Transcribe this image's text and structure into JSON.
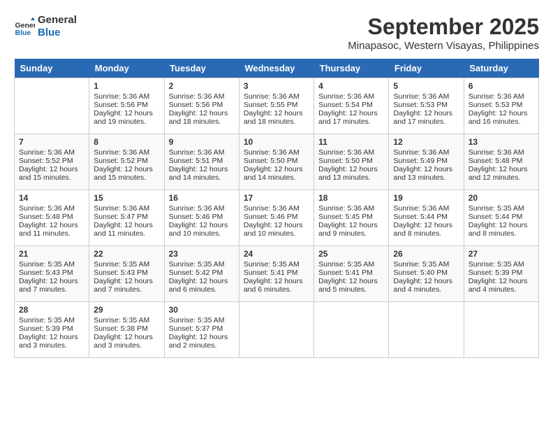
{
  "logo": {
    "line1": "General",
    "line2": "Blue"
  },
  "title": "September 2025",
  "location": "Minapasoc, Western Visayas, Philippines",
  "days_header": [
    "Sunday",
    "Monday",
    "Tuesday",
    "Wednesday",
    "Thursday",
    "Friday",
    "Saturday"
  ],
  "weeks": [
    [
      {
        "day": "",
        "content": ""
      },
      {
        "day": "1",
        "content": "Sunrise: 5:36 AM\nSunset: 5:56 PM\nDaylight: 12 hours\nand 19 minutes."
      },
      {
        "day": "2",
        "content": "Sunrise: 5:36 AM\nSunset: 5:56 PM\nDaylight: 12 hours\nand 18 minutes."
      },
      {
        "day": "3",
        "content": "Sunrise: 5:36 AM\nSunset: 5:55 PM\nDaylight: 12 hours\nand 18 minutes."
      },
      {
        "day": "4",
        "content": "Sunrise: 5:36 AM\nSunset: 5:54 PM\nDaylight: 12 hours\nand 17 minutes."
      },
      {
        "day": "5",
        "content": "Sunrise: 5:36 AM\nSunset: 5:53 PM\nDaylight: 12 hours\nand 17 minutes."
      },
      {
        "day": "6",
        "content": "Sunrise: 5:36 AM\nSunset: 5:53 PM\nDaylight: 12 hours\nand 16 minutes."
      }
    ],
    [
      {
        "day": "7",
        "content": "Sunrise: 5:36 AM\nSunset: 5:52 PM\nDaylight: 12 hours\nand 15 minutes."
      },
      {
        "day": "8",
        "content": "Sunrise: 5:36 AM\nSunset: 5:52 PM\nDaylight: 12 hours\nand 15 minutes."
      },
      {
        "day": "9",
        "content": "Sunrise: 5:36 AM\nSunset: 5:51 PM\nDaylight: 12 hours\nand 14 minutes."
      },
      {
        "day": "10",
        "content": "Sunrise: 5:36 AM\nSunset: 5:50 PM\nDaylight: 12 hours\nand 14 minutes."
      },
      {
        "day": "11",
        "content": "Sunrise: 5:36 AM\nSunset: 5:50 PM\nDaylight: 12 hours\nand 13 minutes."
      },
      {
        "day": "12",
        "content": "Sunrise: 5:36 AM\nSunset: 5:49 PM\nDaylight: 12 hours\nand 13 minutes."
      },
      {
        "day": "13",
        "content": "Sunrise: 5:36 AM\nSunset: 5:48 PM\nDaylight: 12 hours\nand 12 minutes."
      }
    ],
    [
      {
        "day": "14",
        "content": "Sunrise: 5:36 AM\nSunset: 5:48 PM\nDaylight: 12 hours\nand 11 minutes."
      },
      {
        "day": "15",
        "content": "Sunrise: 5:36 AM\nSunset: 5:47 PM\nDaylight: 12 hours\nand 11 minutes."
      },
      {
        "day": "16",
        "content": "Sunrise: 5:36 AM\nSunset: 5:46 PM\nDaylight: 12 hours\nand 10 minutes."
      },
      {
        "day": "17",
        "content": "Sunrise: 5:36 AM\nSunset: 5:46 PM\nDaylight: 12 hours\nand 10 minutes."
      },
      {
        "day": "18",
        "content": "Sunrise: 5:36 AM\nSunset: 5:45 PM\nDaylight: 12 hours\nand 9 minutes."
      },
      {
        "day": "19",
        "content": "Sunrise: 5:36 AM\nSunset: 5:44 PM\nDaylight: 12 hours\nand 8 minutes."
      },
      {
        "day": "20",
        "content": "Sunrise: 5:35 AM\nSunset: 5:44 PM\nDaylight: 12 hours\nand 8 minutes."
      }
    ],
    [
      {
        "day": "21",
        "content": "Sunrise: 5:35 AM\nSunset: 5:43 PM\nDaylight: 12 hours\nand 7 minutes."
      },
      {
        "day": "22",
        "content": "Sunrise: 5:35 AM\nSunset: 5:43 PM\nDaylight: 12 hours\nand 7 minutes."
      },
      {
        "day": "23",
        "content": "Sunrise: 5:35 AM\nSunset: 5:42 PM\nDaylight: 12 hours\nand 6 minutes."
      },
      {
        "day": "24",
        "content": "Sunrise: 5:35 AM\nSunset: 5:41 PM\nDaylight: 12 hours\nand 6 minutes."
      },
      {
        "day": "25",
        "content": "Sunrise: 5:35 AM\nSunset: 5:41 PM\nDaylight: 12 hours\nand 5 minutes."
      },
      {
        "day": "26",
        "content": "Sunrise: 5:35 AM\nSunset: 5:40 PM\nDaylight: 12 hours\nand 4 minutes."
      },
      {
        "day": "27",
        "content": "Sunrise: 5:35 AM\nSunset: 5:39 PM\nDaylight: 12 hours\nand 4 minutes."
      }
    ],
    [
      {
        "day": "28",
        "content": "Sunrise: 5:35 AM\nSunset: 5:39 PM\nDaylight: 12 hours\nand 3 minutes."
      },
      {
        "day": "29",
        "content": "Sunrise: 5:35 AM\nSunset: 5:38 PM\nDaylight: 12 hours\nand 3 minutes."
      },
      {
        "day": "30",
        "content": "Sunrise: 5:35 AM\nSunset: 5:37 PM\nDaylight: 12 hours\nand 2 minutes."
      },
      {
        "day": "",
        "content": ""
      },
      {
        "day": "",
        "content": ""
      },
      {
        "day": "",
        "content": ""
      },
      {
        "day": "",
        "content": ""
      }
    ]
  ]
}
